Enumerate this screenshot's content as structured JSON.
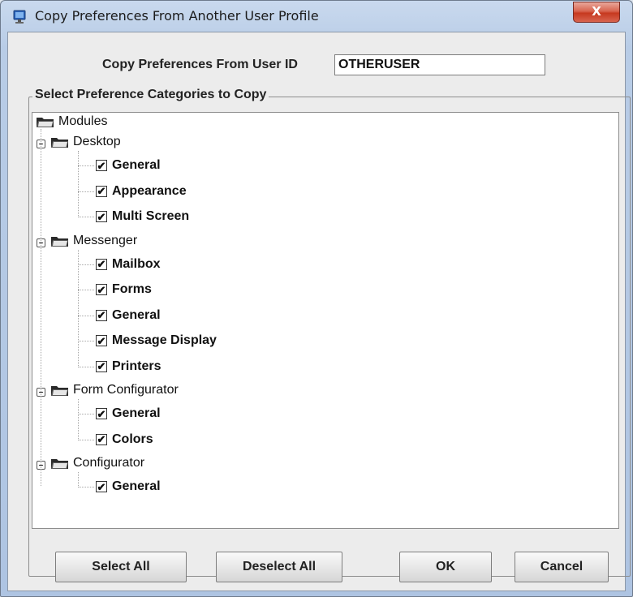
{
  "window": {
    "title": "Copy Preferences From Another User Profile",
    "close_label": "X"
  },
  "user_id": {
    "label": "Copy Preferences From User ID",
    "value": "OTHERUSER"
  },
  "group": {
    "legend": "Select Preference Categories to Copy"
  },
  "tree": {
    "root": "Modules",
    "modules": [
      {
        "label": "Desktop",
        "items": [
          {
            "label": "General",
            "checked": true
          },
          {
            "label": "Appearance",
            "checked": true
          },
          {
            "label": "Multi Screen",
            "checked": true
          }
        ]
      },
      {
        "label": "Messenger",
        "items": [
          {
            "label": "Mailbox",
            "checked": true
          },
          {
            "label": "Forms",
            "checked": true
          },
          {
            "label": "General",
            "checked": true
          },
          {
            "label": "Message Display",
            "checked": true
          },
          {
            "label": "Printers",
            "checked": true
          }
        ]
      },
      {
        "label": "Form Configurator",
        "items": [
          {
            "label": "General",
            "checked": true
          },
          {
            "label": "Colors",
            "checked": true
          }
        ]
      },
      {
        "label": "Configurator",
        "items": [
          {
            "label": "General",
            "checked": true
          }
        ]
      }
    ]
  },
  "buttons": {
    "select_all": "Select All",
    "deselect_all": "Deselect All",
    "ok": "OK",
    "cancel": "Cancel"
  },
  "check_glyph": "✔"
}
